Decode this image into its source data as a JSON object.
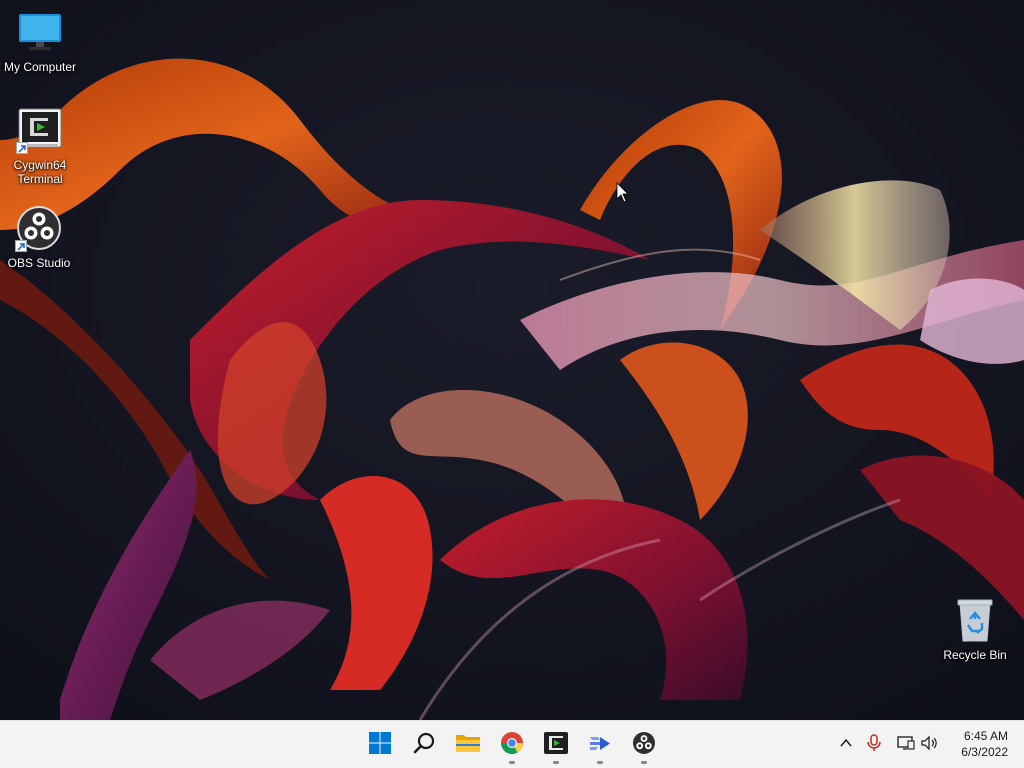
{
  "desktop": {
    "icons": [
      {
        "label": "My Computer",
        "icon": "monitor-icon"
      },
      {
        "label": "Cygwin64\nTerminal",
        "icon": "cygwin-icon"
      },
      {
        "label": "OBS Studio",
        "icon": "obs-icon"
      },
      {
        "label": "Recycle Bin",
        "icon": "recycle-bin-icon"
      }
    ]
  },
  "taskbar": {
    "apps": [
      {
        "name": "Start",
        "icon": "windows-start-icon",
        "running": false
      },
      {
        "name": "Search",
        "icon": "search-icon",
        "running": false
      },
      {
        "name": "File Explorer",
        "icon": "folder-icon",
        "running": false
      },
      {
        "name": "Google Chrome",
        "icon": "chrome-icon",
        "running": true
      },
      {
        "name": "Cygwin64 Terminal",
        "icon": "cygwin-icon",
        "running": true
      },
      {
        "name": "Power Automate",
        "icon": "power-automate-icon",
        "running": true
      },
      {
        "name": "OBS Studio",
        "icon": "obs-icon",
        "running": true
      }
    ],
    "tray": {
      "icons": [
        "chevron-up-icon",
        "microphone-icon",
        "network-icon",
        "speaker-icon"
      ],
      "time": "6:45 AM",
      "date": "6/3/2022"
    }
  },
  "colors": {
    "taskbar_bg": "#f3f3f3",
    "start_blue": "#0078d4",
    "mic_red": "#c42b1c"
  }
}
